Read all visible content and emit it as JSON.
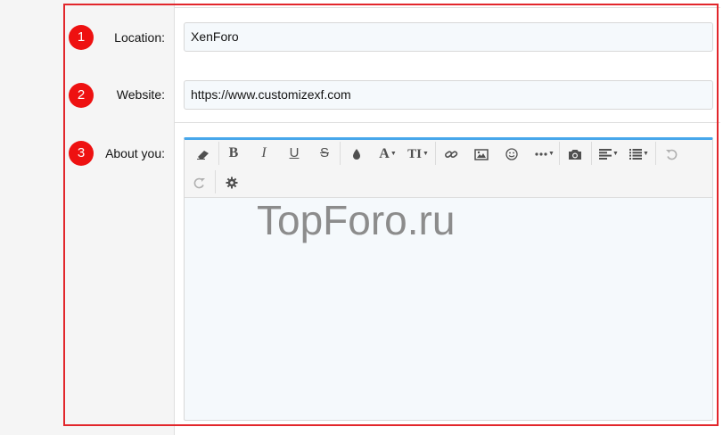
{
  "fields": {
    "location": {
      "number": "1",
      "label": "Location:",
      "value": "XenForo"
    },
    "website": {
      "number": "2",
      "label": "Website:",
      "value": "https://www.customizexf.com"
    },
    "about": {
      "number": "3",
      "label": "About you:"
    }
  },
  "editor": {
    "accent_color": "#47a7eb",
    "toolbar_icons": [
      "eraser-icon",
      "bold-icon",
      "italic-icon",
      "underline-icon",
      "strikethrough-icon",
      "text-color-icon",
      "font-family-icon",
      "font-size-icon",
      "link-icon",
      "image-icon",
      "smilie-icon",
      "more-icon",
      "camera-icon",
      "align-icon",
      "list-icon",
      "undo-icon",
      "redo-icon",
      "settings-icon"
    ],
    "glyphs": {
      "bold": "B",
      "italic": "I",
      "underline": "U",
      "strike": "S",
      "font": "A",
      "size": "TI"
    }
  },
  "watermark": "TopForo.ru",
  "colors": {
    "highlight_border": "#e2262b",
    "badge": "#ee1111"
  }
}
